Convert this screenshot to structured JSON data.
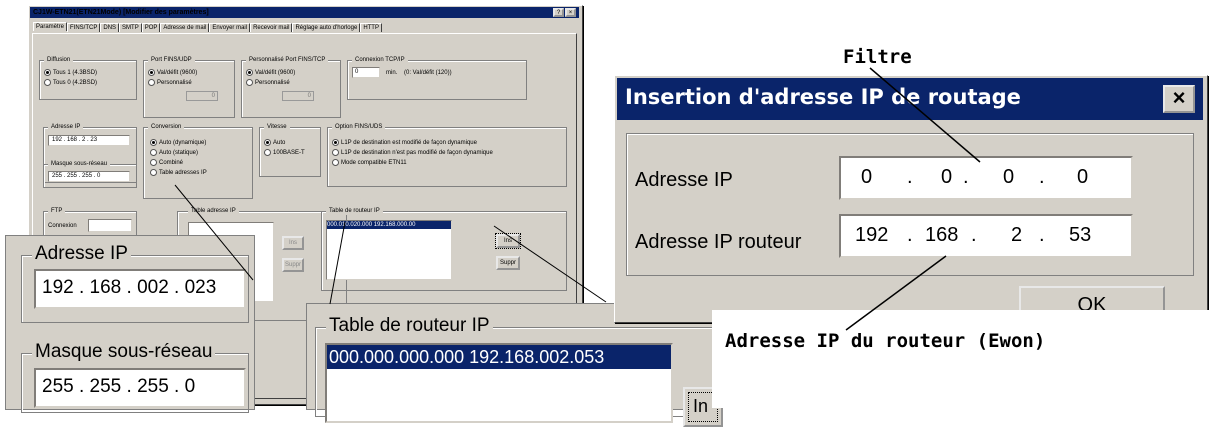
{
  "left_dialog": {
    "title": "CJ1W-ETN21(ETN21Mode) [Modifier des paramètres]",
    "title_buttons": {
      "help": "?",
      "close": "×"
    },
    "tabs": [
      "Paramètre",
      "FINS/TCP",
      "DNS",
      "SMTP",
      "POP",
      "Adresse de mail",
      "Envoyer mail",
      "Recevoir mail",
      "Réglage auto d'horloge",
      "HTTP"
    ],
    "diffusion": {
      "label": "Diffusion",
      "options": [
        "Tous 1 (4.3BSD)",
        "Tous 0 (4.2BSD)"
      ],
      "selected": 0
    },
    "port_fins_udp": {
      "label": "Port FINS/UDP",
      "options": [
        "Val/défit (9600)",
        "Personnalisé"
      ],
      "selected": 0,
      "value": "0"
    },
    "port_fins_tcp": {
      "label": "Personnalisé Port FINS/TCP",
      "options": [
        "Val/défit (9600)",
        "Personnalisé"
      ],
      "selected": 0,
      "value": "0"
    },
    "tcpip": {
      "label": "Connexion TCP/IP",
      "value": "0",
      "unit": "min.",
      "hint": "(0: Val/défit (120))"
    },
    "adresse_ip": {
      "label": "Adresse IP",
      "value": "192 . 168 . 2 . 23"
    },
    "masque": {
      "label": "Masque sous-réseau",
      "value": "255 . 255 . 255 . 0"
    },
    "conversion": {
      "label": "Conversion",
      "options": [
        "Auto (dynamique)",
        "Auto (statique)",
        "Combiné",
        "Table adresses IP"
      ],
      "selected": 0
    },
    "vitesse": {
      "label": "Vitesse",
      "options": [
        "Auto",
        "100BASE-T"
      ],
      "selected": 0
    },
    "option_fins": {
      "label": "Option FINS/UDS",
      "options": [
        "L1P de destination est modifié de façon dynamique",
        "L1P de destination n'est pas modifié de façon dynamique",
        "Mode compatible ETN11"
      ],
      "selected": 0
    },
    "ftp": {
      "label": "FTP",
      "connexion_label": "Connexion"
    },
    "table_adresse_ip": {
      "label": "Table adresse IP"
    },
    "table_routeur_ip": {
      "label": "Table de routeur IP",
      "row": "000.010.020.000 192.168.000.00",
      "insert_button": "Ins",
      "delete_button": "Suppr"
    },
    "left_buttons": {
      "insert": "Ins",
      "delete": "Suppr"
    }
  },
  "zoom_ip": {
    "label": "Adresse IP",
    "value": "192 . 168 . 002 . 023"
  },
  "zoom_mask": {
    "label": "Masque sous-réseau",
    "value": "255 . 255 . 255 .  0"
  },
  "zoom_routeur": {
    "label": "Table de routeur IP",
    "row": "000.000.000.000 192.168.002.053",
    "button_fragment": "In"
  },
  "right_dialog": {
    "title": "Insertion d'adresse IP de routage",
    "close": "×",
    "ip_label": "Adresse IP",
    "ip_octets": [
      "0",
      "0",
      "0",
      "0"
    ],
    "router_label": "Adresse IP routeur",
    "router_octets": [
      "192",
      "168",
      "2",
      "53"
    ],
    "ok_button": "OK",
    "dot": "."
  },
  "annotations": {
    "filtre": "Filtre",
    "routeur": "Adresse IP du routeur (Ewon)"
  }
}
